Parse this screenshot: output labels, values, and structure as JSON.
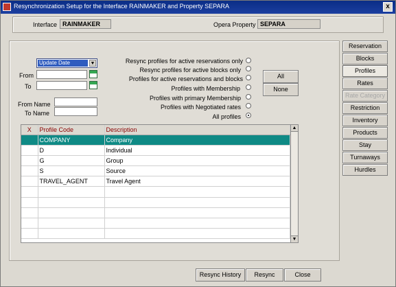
{
  "window": {
    "title": "Resynchronization Setup for the Interface RAINMAKER and Property SEPARA",
    "close_label": "x"
  },
  "header": {
    "interface_label": "Interface",
    "interface_value": "RAINMAKER",
    "property_label": "Opera Property",
    "property_value": "SEPARA"
  },
  "filters": {
    "date_type": "Update Date",
    "from_label": "From",
    "to_label": "To",
    "from_name_label": "From Name",
    "to_name_label": "To Name"
  },
  "options": [
    "Resync profiles for active reservations only",
    "Resync profiles for active blocks only",
    "Profiles for active reservations and blocks",
    "Profiles with Membership",
    "Profiles with primary Membership",
    "Profiles with Negotiated rates",
    "All profiles"
  ],
  "option_selected": 6,
  "buttons": {
    "all": "All",
    "none": "None",
    "resync_history": "Resync History",
    "resync": "Resync",
    "close": "Close"
  },
  "table": {
    "headers": [
      "X",
      "Profile Code",
      "Description"
    ],
    "rows": [
      [
        "COMPANY",
        "Company"
      ],
      [
        "D",
        "Individual"
      ],
      [
        "G",
        "Group"
      ],
      [
        "S",
        "Source"
      ],
      [
        "TRAVEL_AGENT",
        "Travel Agent"
      ],
      [
        "",
        ""
      ],
      [
        "",
        ""
      ],
      [
        "",
        ""
      ],
      [
        "",
        ""
      ],
      [
        "",
        ""
      ]
    ]
  },
  "side_menu": [
    {
      "label": "Reservation",
      "state": "normal"
    },
    {
      "label": "Blocks",
      "state": "normal"
    },
    {
      "label": "Profiles",
      "state": "active"
    },
    {
      "label": "Rates",
      "state": "normal"
    },
    {
      "label": "Rate Category",
      "state": "disabled"
    },
    {
      "label": "Restriction",
      "state": "normal"
    },
    {
      "label": "Inventory",
      "state": "normal"
    },
    {
      "label": "Products",
      "state": "normal"
    },
    {
      "label": "Stay",
      "state": "normal"
    },
    {
      "label": "Turnaways",
      "state": "normal"
    },
    {
      "label": "Hurdles",
      "state": "normal"
    }
  ],
  "colors": {
    "title_bar": "#0a2d86",
    "selected_row": "#0f8a85",
    "header_text": "#8b0000"
  }
}
